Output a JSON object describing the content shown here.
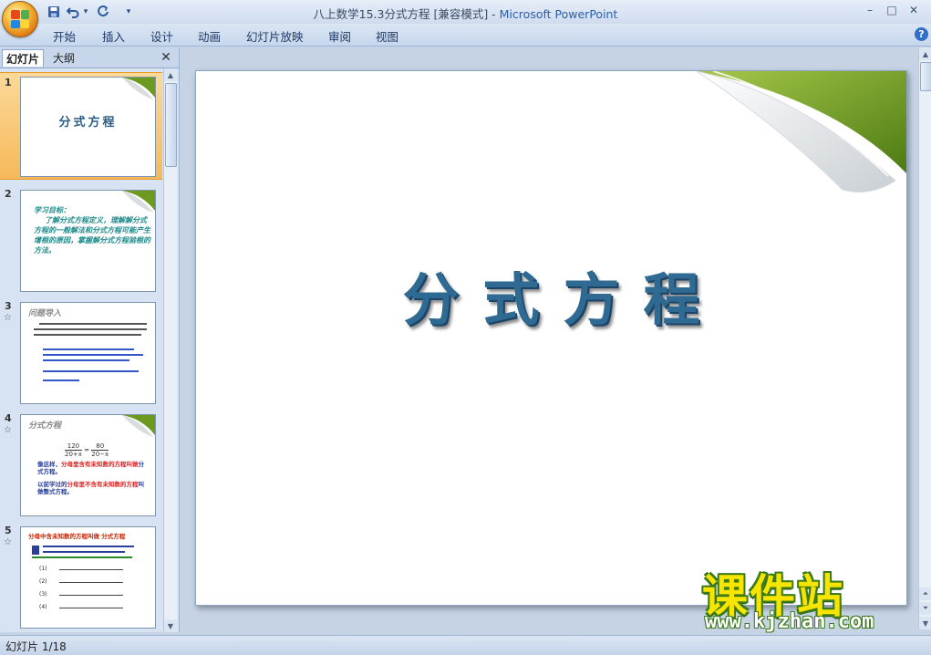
{
  "window": {
    "document_title": "八上数学15.3分式方程 [兼容模式]",
    "separator": " - ",
    "app_name": "Microsoft PowerPoint",
    "controls": {
      "minimize": "–",
      "maximize": "□",
      "close": "✕"
    }
  },
  "quick_access": {
    "save_icon": "save-icon",
    "undo_icon": "undo-icon",
    "redo_icon": "redo-icon",
    "undo_dropdown": "▾",
    "customize": "▾"
  },
  "ribbon": {
    "tabs": [
      "开始",
      "插入",
      "设计",
      "动画",
      "幻灯片放映",
      "审阅",
      "视图"
    ],
    "help": "?"
  },
  "side_panel": {
    "tabs": [
      "幻灯片",
      "大纲"
    ],
    "close": "✕",
    "selected_index": 1,
    "thumbnails": [
      {
        "number": "1",
        "title": "分式方程"
      },
      {
        "number": "2",
        "heading": "学习目标：",
        "body": "了解分式方程定义，理解解分式方程的一般解法和分式方程可能产生增根的原因，掌握解分式方程验根的方法。"
      },
      {
        "number": "3",
        "star": "☆",
        "heading": "问题导入"
      },
      {
        "number": "4",
        "star": "☆",
        "heading": "分式方程",
        "fraction_num_left": "120",
        "fraction_den_left": "20+x",
        "fraction_num_right": "80",
        "fraction_den_right": "20−x",
        "text_a_blue": "像这样，",
        "text_a_red": "分母里含有未知数的方程叫做",
        "text_a_end": "分式方程。",
        "text_b_blue": "以前学过的",
        "text_b_red": "分母里不含有未知数的方程",
        "text_b_end": "叫做整式方程。"
      },
      {
        "number": "5",
        "star": "☆",
        "heading": "分母中含未知数的方程叫做 分式方程",
        "rows": [
          "(1)",
          "(2)",
          "(3)",
          "(4)"
        ]
      }
    ]
  },
  "slide": {
    "title": "分式方程"
  },
  "watermark": {
    "brand": "课件站",
    "url": "www.kjzhan.com"
  },
  "status": {
    "slide_indicator": "幻灯片 1/18"
  },
  "colors": {
    "accent_green": "#6b9a1e",
    "title_blue": "#2f6a93",
    "selection_orange": "#f6b95a"
  }
}
